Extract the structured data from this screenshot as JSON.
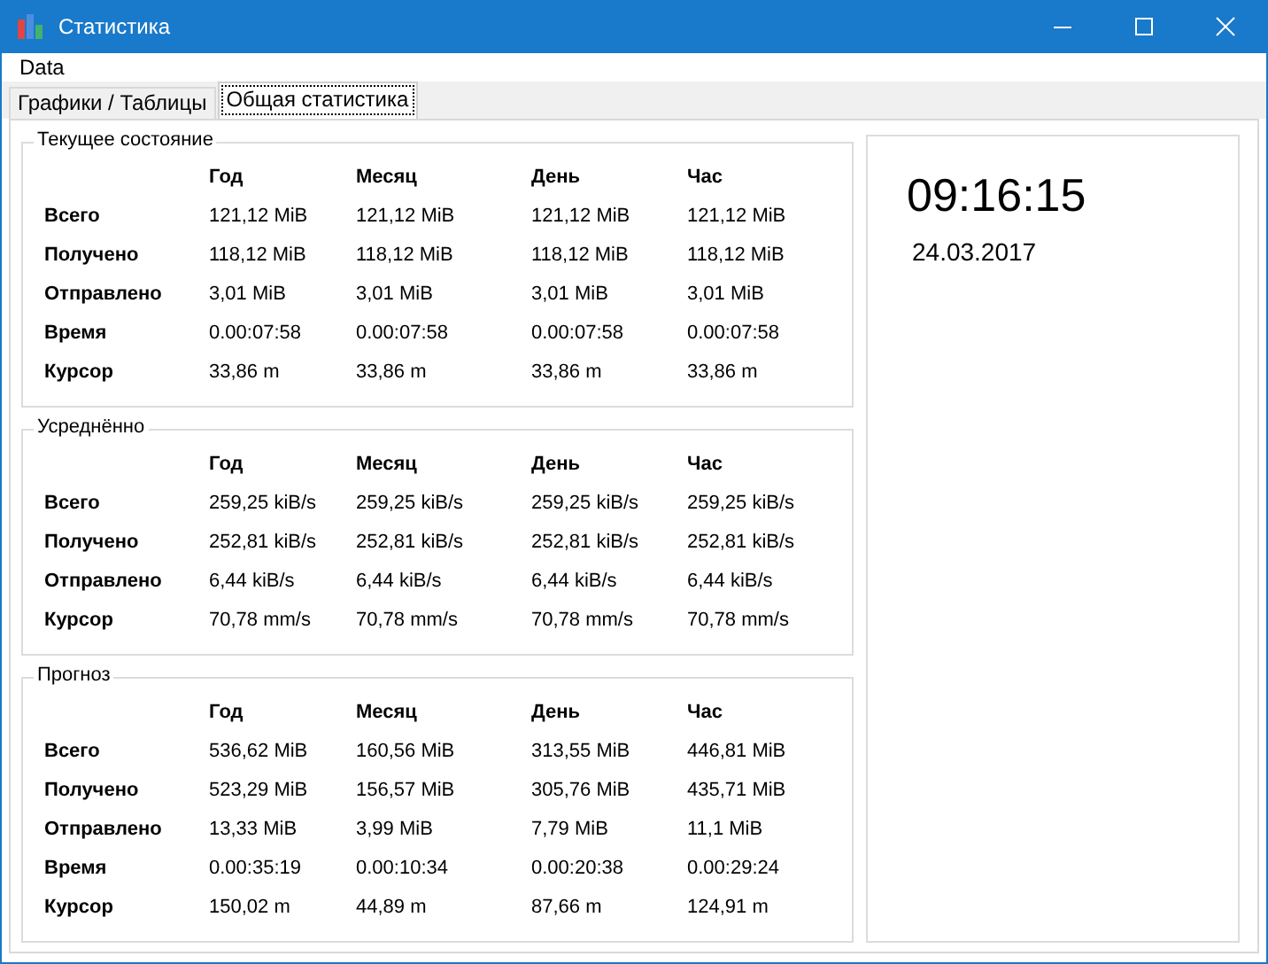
{
  "window": {
    "title": "Статистика"
  },
  "menu": [
    "Data"
  ],
  "tabs": [
    {
      "label": "Графики / Таблицы",
      "selected": false
    },
    {
      "label": "Общая статистика",
      "selected": true
    }
  ],
  "groups": [
    {
      "title": "Текущее состояние",
      "columns": [
        "Год",
        "Месяц",
        "День",
        "Час"
      ],
      "rows": [
        {
          "label": "Всего",
          "values": [
            "121,12 MiB",
            "121,12 MiB",
            "121,12 MiB",
            "121,12 MiB"
          ]
        },
        {
          "label": "Получено",
          "values": [
            "118,12 MiB",
            "118,12 MiB",
            "118,12 MiB",
            "118,12 MiB"
          ]
        },
        {
          "label": "Отправлено",
          "values": [
            "3,01 MiB",
            "3,01 MiB",
            "3,01 MiB",
            "3,01 MiB"
          ]
        },
        {
          "label": "Время",
          "values": [
            "0.00:07:58",
            "0.00:07:58",
            "0.00:07:58",
            "0.00:07:58"
          ]
        },
        {
          "label": "Курсор",
          "values": [
            "33,86 m",
            "33,86 m",
            "33,86 m",
            "33,86 m"
          ]
        }
      ]
    },
    {
      "title": "Усреднённо",
      "columns": [
        "Год",
        "Месяц",
        "День",
        "Час"
      ],
      "rows": [
        {
          "label": "Всего",
          "values": [
            "259,25 kiB/s",
            "259,25 kiB/s",
            "259,25 kiB/s",
            "259,25 kiB/s"
          ]
        },
        {
          "label": "Получено",
          "values": [
            "252,81 kiB/s",
            "252,81 kiB/s",
            "252,81 kiB/s",
            "252,81 kiB/s"
          ]
        },
        {
          "label": "Отправлено",
          "values": [
            "6,44 kiB/s",
            "6,44 kiB/s",
            "6,44 kiB/s",
            "6,44 kiB/s"
          ]
        },
        {
          "label": "Курсор",
          "values": [
            "70,78 mm/s",
            "70,78 mm/s",
            "70,78 mm/s",
            "70,78 mm/s"
          ]
        }
      ]
    },
    {
      "title": "Прогноз",
      "columns": [
        "Год",
        "Месяц",
        "День",
        "Час"
      ],
      "rows": [
        {
          "label": "Всего",
          "values": [
            "536,62 MiB",
            "160,56 MiB",
            "313,55 MiB",
            "446,81 MiB"
          ]
        },
        {
          "label": "Получено",
          "values": [
            "523,29 MiB",
            "156,57 MiB",
            "305,76 MiB",
            "435,71 MiB"
          ]
        },
        {
          "label": "Отправлено",
          "values": [
            "13,33 MiB",
            "3,99 MiB",
            "7,79 MiB",
            "11,1 MiB"
          ]
        },
        {
          "label": "Время",
          "values": [
            "0.00:35:19",
            "0.00:10:34",
            "0.00:20:38",
            "0.00:29:24"
          ]
        },
        {
          "label": "Курсор",
          "values": [
            "150,02 m",
            "44,89 m",
            "87,66 m",
            "124,91 m"
          ]
        }
      ]
    }
  ],
  "clock": {
    "time": "09:16:15",
    "date": "24.03.2017"
  }
}
